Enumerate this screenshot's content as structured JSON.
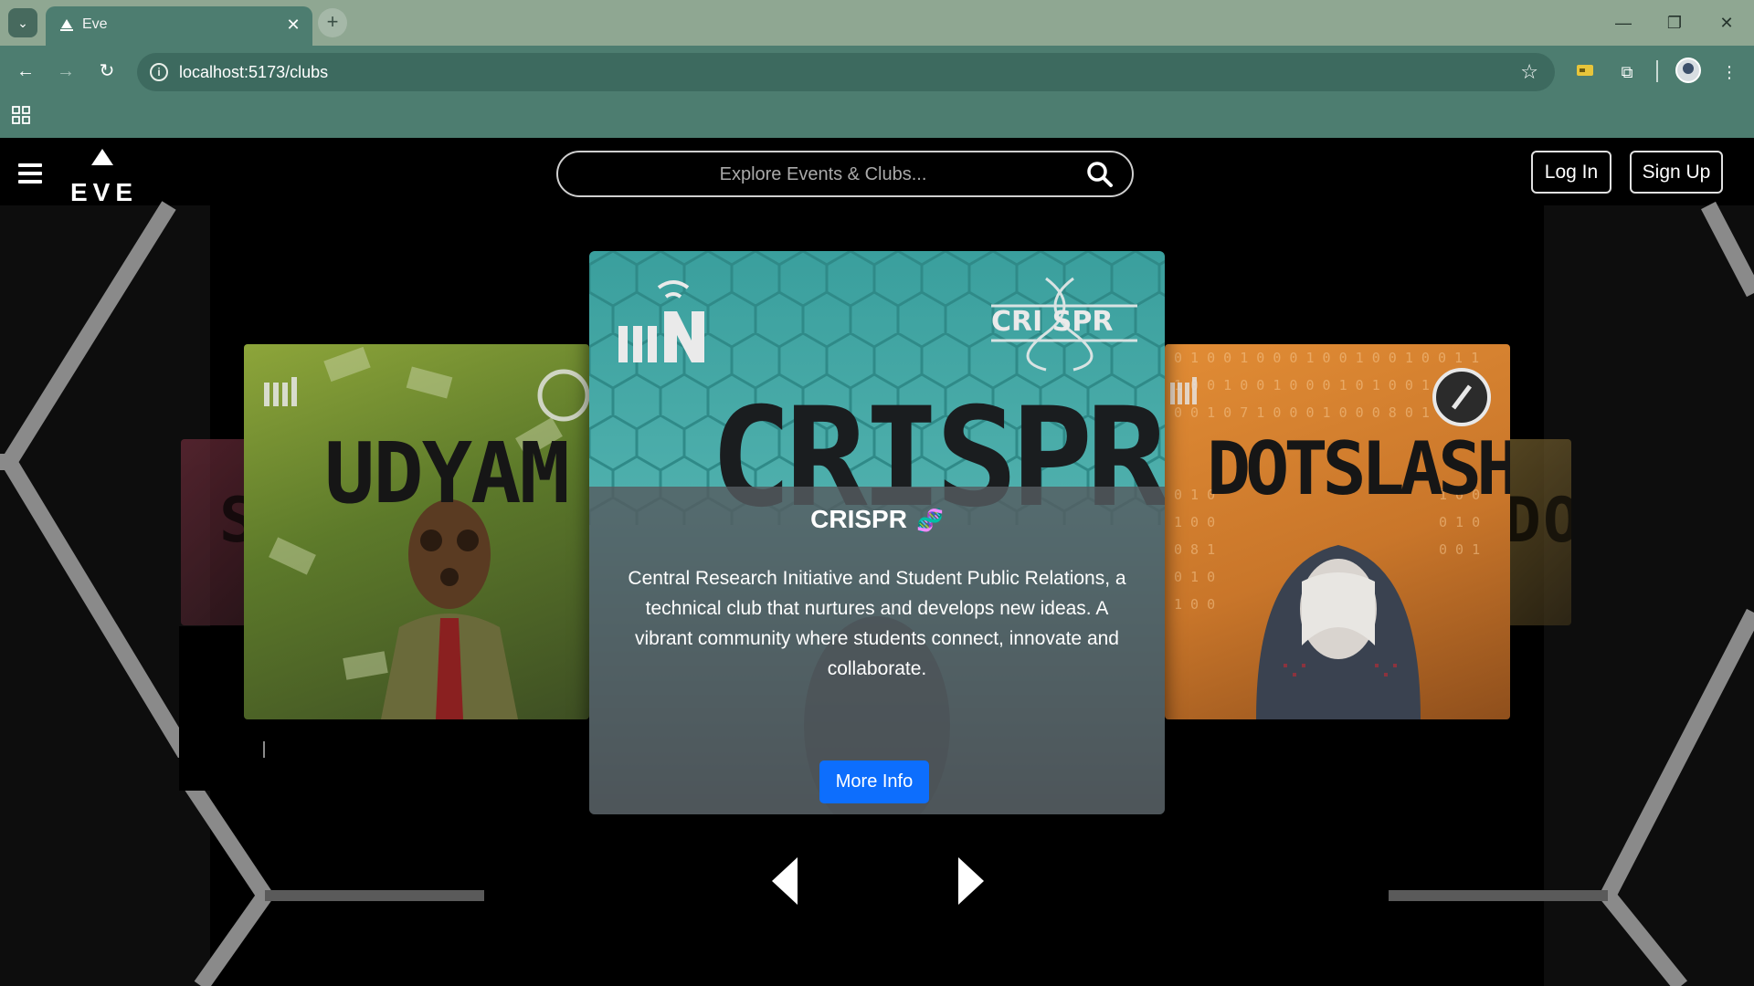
{
  "browser": {
    "tab_title": "Eve",
    "url": "localhost:5173/clubs"
  },
  "site": {
    "logo_text": "EVE",
    "search_placeholder": "Explore Events & Clubs...",
    "login_label": "Log In",
    "signup_label": "Sign Up"
  },
  "carousel": {
    "active": {
      "name": "CRISPR",
      "description": "Central Research Initiative and Student Public Relations, a technical club that nurtures and develops new ideas. A vibrant community where students connect, innovate and collaborate.",
      "button_label": "More Info",
      "poster_word": "CRISPR",
      "poster_logo_text": "CRI SPR"
    },
    "left_card": {
      "poster_word": "UDYAM"
    },
    "right_card": {
      "poster_word": "DOTSLASH"
    },
    "far_left_card": {
      "poster_word": "ST"
    },
    "far_right_card": {
      "poster_word": "DO"
    }
  },
  "colors": {
    "accent": "#0d6efd",
    "tab_green": "#4d7d70",
    "tabstrip": "#8fa792"
  }
}
